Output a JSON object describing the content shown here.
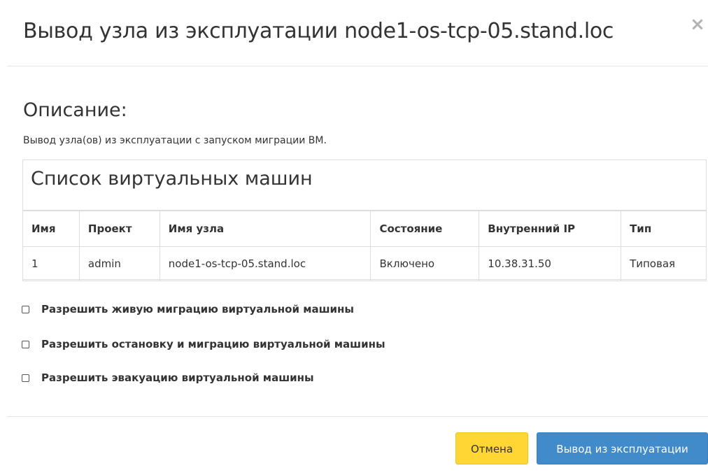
{
  "modal": {
    "title": "Вывод узла из эксплуатации node1-os-tcp-05.stand.loc",
    "close_icon": "×"
  },
  "description": {
    "heading": "Описание:",
    "text": "Вывод узла(ов) из эксплуатации с запуском миграции ВМ."
  },
  "vm_list": {
    "title": "Список виртуальных машин",
    "columns": [
      "Имя",
      "Проект",
      "Имя узла",
      "Состояние",
      "Внутренний IP",
      "Тип"
    ],
    "rows": [
      [
        "1",
        "admin",
        "node1-os-tcp-05.stand.loc",
        "Включено",
        "10.38.31.50",
        "Типовая"
      ]
    ]
  },
  "options": [
    {
      "label": "Разрешить живую миграцию виртуальной машины",
      "checked": false
    },
    {
      "label": "Разрешить остановку и миграцию виртуальной машины",
      "checked": false
    },
    {
      "label": "Разрешить эвакуацию виртуальной машины",
      "checked": false
    }
  ],
  "footer": {
    "cancel_label": "Отмена",
    "submit_label": "Вывод из эксплуатации"
  },
  "colors": {
    "cancel_button": "#ffd633",
    "submit_button": "#428bca"
  }
}
